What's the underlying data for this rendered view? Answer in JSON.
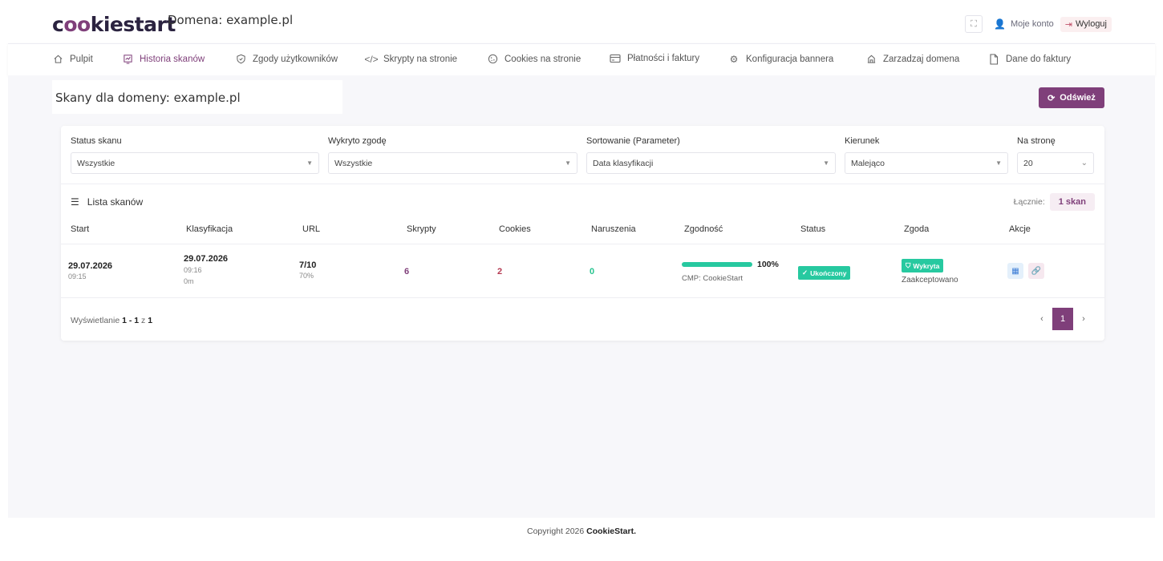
{
  "header": {
    "logo_pre": "c",
    "logo_oo": "oo",
    "logo_post": "kiestart",
    "domain_title": "Domena: example.pl",
    "account_label": "Moje konto",
    "logout_label": "Wyloguj"
  },
  "nav": {
    "items": [
      {
        "label": "Pulpit",
        "icon": "home-icon"
      },
      {
        "label": "Historia skanów",
        "icon": "chart-icon"
      },
      {
        "label": "Zgody użytkowników",
        "icon": "shield-icon"
      },
      {
        "label": "Skrypty na stronie",
        "icon": "code-icon"
      },
      {
        "label": "Cookies na stronie",
        "icon": "cookie-icon"
      },
      {
        "label": "Płatności i faktury",
        "icon": "card-icon"
      },
      {
        "label": "Konfiguracja bannera",
        "icon": "gear-icon"
      },
      {
        "label": "Zarzadzaj domena",
        "icon": "building-icon"
      },
      {
        "label": "Dane do faktury",
        "icon": "document-icon"
      }
    ]
  },
  "page": {
    "heading": "Skany dla domeny: example.pl",
    "refresh_label": "Odśwież"
  },
  "filters": {
    "status": {
      "label": "Status skanu",
      "value": "Wszystkie"
    },
    "consent": {
      "label": "Wykryto zgodę",
      "value": "Wszystkie"
    },
    "sort": {
      "label": "Sortowanie (Parameter)",
      "value": "Data klasyfikacji"
    },
    "direction": {
      "label": "Kierunek",
      "value": "Malejąco"
    },
    "per_page": {
      "label": "Na stronę",
      "value": "20"
    }
  },
  "list": {
    "title": "Lista skanów",
    "total_label": "Łącznie:",
    "total_value": "1 skan",
    "columns": [
      "Start",
      "Klasyfikacja",
      "URL",
      "Skrypty",
      "Cookies",
      "Naruszenia",
      "Zgodność",
      "Status",
      "Zgoda",
      "Akcje"
    ],
    "rows": [
      {
        "start_date": "29.07.2026",
        "start_time": "09:15",
        "class_date": "29.07.2026",
        "class_time": "09:16",
        "class_duration": "0m",
        "url_count": "7/10",
        "url_pct": "70%",
        "scripts": "6",
        "cookies": "2",
        "violations": "0",
        "compliance_pct": "100%",
        "compliance_value": 1.0,
        "cmp": "CMP: CookieStart",
        "status": "Ukończony",
        "consent_badge": "Wykryta",
        "consent_text": "Zaakceptowano"
      }
    ]
  },
  "pagination": {
    "showing_prefix": "Wyświetlanie",
    "range": "1 - 1",
    "of": "z",
    "total": "1",
    "current_page": "1"
  },
  "footer": {
    "prefix": "Copyright 2026",
    "brand": "CookieStart."
  },
  "colors": {
    "brand": "#7f3f7a",
    "success": "#27c9a0",
    "danger": "#b53a52"
  }
}
